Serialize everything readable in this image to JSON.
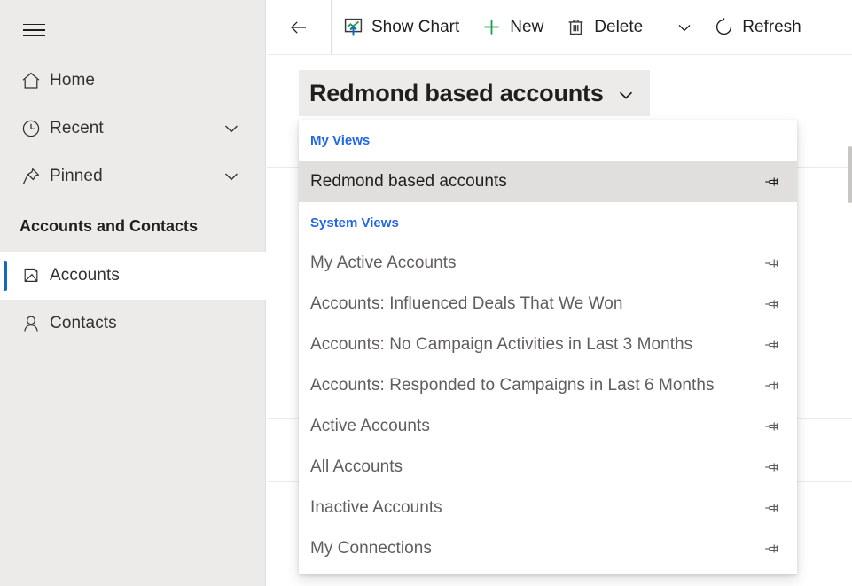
{
  "sidebar": {
    "hamburger_icon": "hamburger-menu-icon",
    "items": [
      {
        "label": "Home",
        "icon": "home-icon",
        "expandable": false,
        "selected": false
      },
      {
        "label": "Recent",
        "icon": "clock-icon",
        "expandable": true,
        "selected": false
      },
      {
        "label": "Pinned",
        "icon": "pin-icon",
        "expandable": true,
        "selected": false
      }
    ],
    "group_title": "Accounts and Contacts",
    "group_items": [
      {
        "label": "Accounts",
        "icon": "accounts-icon",
        "selected": true
      },
      {
        "label": "Contacts",
        "icon": "contact-person-icon",
        "selected": false
      }
    ],
    "accent_color": "#0F6CBD",
    "background_color": "#EDEBE9"
  },
  "commandbar": {
    "back_icon": "back-arrow-icon",
    "buttons": [
      {
        "label": "Show Chart",
        "icon": "show-chart-icon"
      },
      {
        "label": "New",
        "icon": "plus-icon"
      },
      {
        "label": "Delete",
        "icon": "trash-icon"
      }
    ],
    "overflow_icon": "chevron-down-icon",
    "refresh": {
      "label": "Refresh",
      "icon": "refresh-icon"
    }
  },
  "view_selector": {
    "title": "Redmond based accounts",
    "chevron_icon": "chevron-down-icon",
    "expanded": true
  },
  "view_flyout": {
    "sections": [
      {
        "header": "My Views",
        "items": [
          {
            "label": "Redmond based accounts",
            "selected": true,
            "pin_icon": "pin-icon"
          }
        ]
      },
      {
        "header": "System Views",
        "items": [
          {
            "label": "My Active Accounts",
            "selected": false,
            "pin_icon": "pin-icon"
          },
          {
            "label": "Accounts: Influenced Deals That We Won",
            "selected": false,
            "pin_icon": "pin-icon"
          },
          {
            "label": "Accounts: No Campaign Activities in Last 3 Months",
            "selected": false,
            "pin_icon": "pin-icon"
          },
          {
            "label": "Accounts: Responded to Campaigns in Last 6 Months",
            "selected": false,
            "pin_icon": "pin-icon"
          },
          {
            "label": "Active Accounts",
            "selected": false,
            "pin_icon": "pin-icon"
          },
          {
            "label": "All Accounts",
            "selected": false,
            "pin_icon": "pin-icon"
          },
          {
            "label": "Inactive Accounts",
            "selected": false,
            "pin_icon": "pin-icon"
          },
          {
            "label": "My Connections",
            "selected": false,
            "pin_icon": "pin-icon"
          }
        ]
      }
    ],
    "section_color": "#2266E8",
    "selected_row_color": "#E1DFDD"
  }
}
